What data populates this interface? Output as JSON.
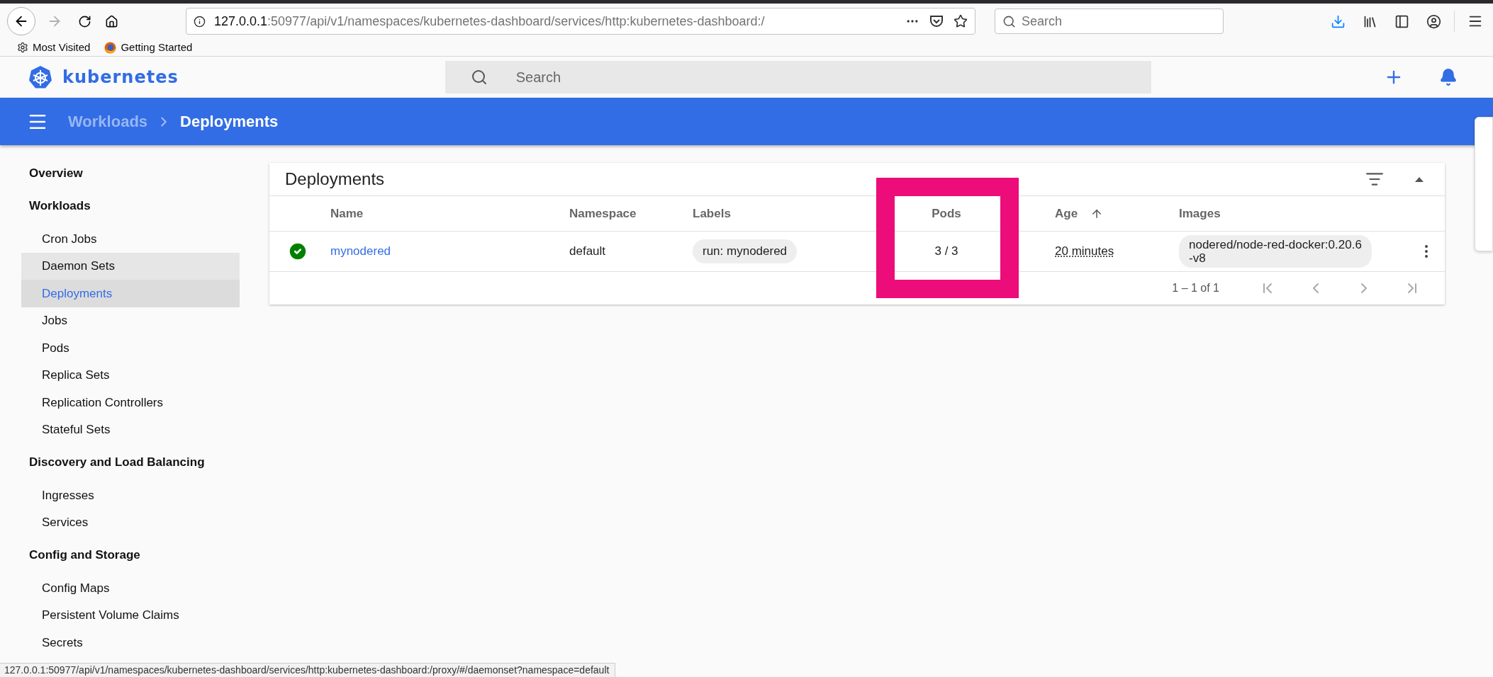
{
  "browser": {
    "back_enabled": true,
    "forward_enabled": false,
    "address": {
      "host": "127.0.0.1",
      "path": ":50977/api/v1/namespaces/kubernetes-dashboard/services/http:kubernetes-dashboard:/"
    },
    "search": {
      "placeholder": "Search"
    },
    "bookmarks": [
      {
        "label": "Most Visited",
        "kind": "gear"
      },
      {
        "label": "Getting Started",
        "kind": "firefox"
      }
    ]
  },
  "app": {
    "brand": "kubernetes",
    "search": {
      "placeholder": "Search"
    }
  },
  "breadcrumb": [
    {
      "label": "Workloads",
      "current": false
    },
    {
      "label": "Deployments",
      "current": true
    }
  ],
  "sidebar": {
    "sections": [
      {
        "title": "Overview"
      },
      {
        "title": "Workloads",
        "children": [
          {
            "label": "Cron Jobs",
            "selected": false,
            "hovered": false
          },
          {
            "label": "Daemon Sets",
            "selected": false,
            "hovered": true
          },
          {
            "label": "Deployments",
            "selected": true,
            "hovered": false
          },
          {
            "label": "Jobs",
            "selected": false,
            "hovered": false
          },
          {
            "label": "Pods",
            "selected": false,
            "hovered": false
          },
          {
            "label": "Replica Sets",
            "selected": false,
            "hovered": false
          },
          {
            "label": "Replication Controllers",
            "selected": false,
            "hovered": false
          },
          {
            "label": "Stateful Sets",
            "selected": false,
            "hovered": false
          }
        ]
      },
      {
        "title": "Discovery and Load Balancing",
        "children": [
          {
            "label": "Ingresses",
            "selected": false,
            "hovered": false
          },
          {
            "label": "Services",
            "selected": false,
            "hovered": false
          }
        ]
      },
      {
        "title": "Config and Storage",
        "children": [
          {
            "label": "Config Maps",
            "selected": false,
            "hovered": false
          },
          {
            "label": "Persistent Volume Claims",
            "selected": false,
            "hovered": false
          },
          {
            "label": "Secrets",
            "selected": false,
            "hovered": false
          }
        ]
      }
    ]
  },
  "card": {
    "title": "Deployments",
    "expanded": true,
    "columns": [
      {
        "label": "Name",
        "sorted": false,
        "highlighted": false
      },
      {
        "label": "Namespace",
        "sorted": false,
        "highlighted": false
      },
      {
        "label": "Labels",
        "sorted": false,
        "highlighted": false
      },
      {
        "label": "Pods",
        "sorted": false,
        "highlighted": true
      },
      {
        "label": "Age",
        "sorted": true,
        "highlighted": false
      },
      {
        "label": "Images",
        "sorted": false,
        "highlighted": false
      }
    ],
    "rows": [
      {
        "healthy": true,
        "name": "mynodered",
        "namespace": "default",
        "labels": [
          "run: mynodered"
        ],
        "pods": "3 / 3",
        "age": "20 minutes",
        "image": "nodered/node-red-docker:0.20.6-v8"
      }
    ],
    "pagination": "1 – 1 of 1"
  },
  "status_bar": {
    "url": "127.0.0.1:50977/api/v1/namespaces/kubernetes-dashboard/services/http:kubernetes-dashboard:/proxy/#/daemonset?namespace=default"
  }
}
